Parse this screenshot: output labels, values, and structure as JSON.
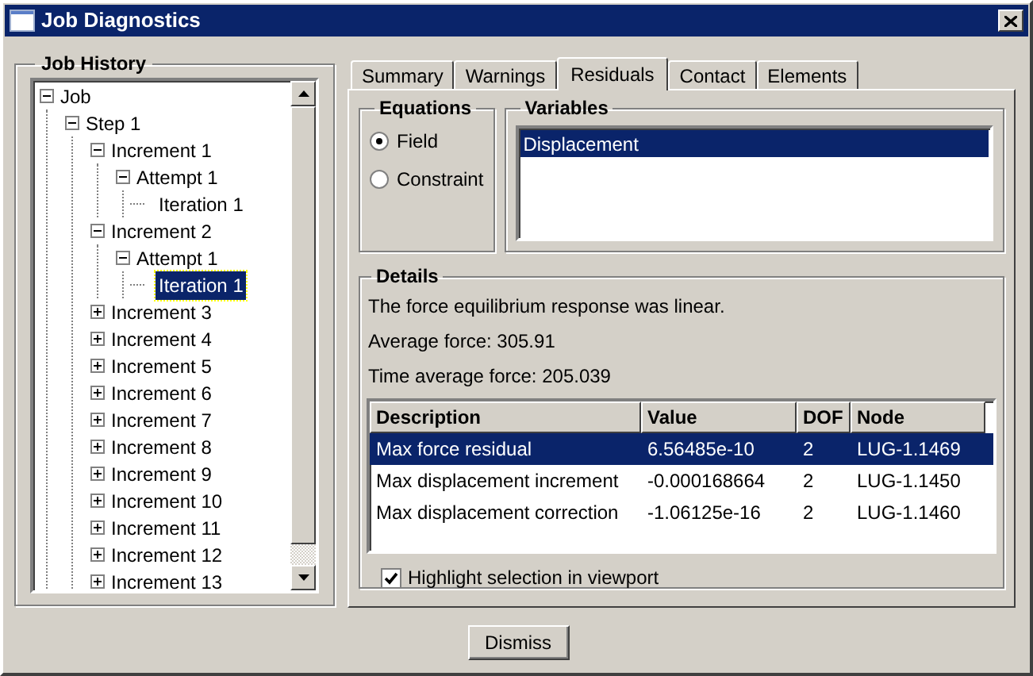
{
  "window": {
    "title": "Job Diagnostics"
  },
  "job_history": {
    "title": "Job History",
    "tree": [
      {
        "label": "Job",
        "expanded": true,
        "selected": false,
        "children": [
          {
            "label": "Step 1",
            "expanded": true,
            "selected": false,
            "children": [
              {
                "label": "Increment 1",
                "expanded": true,
                "selected": false,
                "children": [
                  {
                    "label": "Attempt 1",
                    "expanded": true,
                    "selected": false,
                    "children": [
                      {
                        "label": "Iteration 1",
                        "selected": false
                      }
                    ]
                  }
                ]
              },
              {
                "label": "Increment 2",
                "expanded": true,
                "selected": false,
                "children": [
                  {
                    "label": "Attempt 1",
                    "expanded": true,
                    "selected": false,
                    "children": [
                      {
                        "label": "Iteration 1",
                        "selected": true
                      }
                    ]
                  }
                ]
              },
              {
                "label": "Increment 3",
                "expanded": false,
                "selected": false
              },
              {
                "label": "Increment 4",
                "expanded": false,
                "selected": false
              },
              {
                "label": "Increment 5",
                "expanded": false,
                "selected": false
              },
              {
                "label": "Increment 6",
                "expanded": false,
                "selected": false
              },
              {
                "label": "Increment 7",
                "expanded": false,
                "selected": false
              },
              {
                "label": "Increment 8",
                "expanded": false,
                "selected": false
              },
              {
                "label": "Increment 9",
                "expanded": false,
                "selected": false
              },
              {
                "label": "Increment 10",
                "expanded": false,
                "selected": false
              },
              {
                "label": "Increment 11",
                "expanded": false,
                "selected": false
              },
              {
                "label": "Increment 12",
                "expanded": false,
                "selected": false
              },
              {
                "label": "Increment 13",
                "expanded": false,
                "selected": false
              }
            ]
          }
        ]
      }
    ]
  },
  "tabs": [
    {
      "label": "Summary",
      "selected": false
    },
    {
      "label": "Warnings",
      "selected": false
    },
    {
      "label": "Residuals",
      "selected": true
    },
    {
      "label": "Contact",
      "selected": false
    },
    {
      "label": "Elements",
      "selected": false
    }
  ],
  "equations": {
    "title": "Equations",
    "options": [
      {
        "label": "Field",
        "selected": true
      },
      {
        "label": "Constraint",
        "selected": false
      }
    ]
  },
  "variables": {
    "title": "Variables",
    "items": [
      {
        "label": "Displacement",
        "selected": true
      }
    ]
  },
  "details": {
    "title": "Details",
    "lines": [
      "The force equilibrium response was linear.",
      "Average force: 305.91",
      "Time average force: 205.039"
    ],
    "table": {
      "columns": [
        "Description",
        "Value",
        "DOF",
        "Node"
      ],
      "rows": [
        {
          "cells": [
            "Max force residual",
            "6.56485e-10",
            "2",
            "LUG-1.1469"
          ],
          "selected": true
        },
        {
          "cells": [
            "Max displacement increment",
            "-0.000168664",
            "2",
            "LUG-1.1450"
          ],
          "selected": false
        },
        {
          "cells": [
            "Max displacement correction",
            "-1.06125e-16",
            "2",
            "LUG-1.1460"
          ],
          "selected": false
        }
      ]
    },
    "highlight_checkbox": {
      "label": "Highlight selection in viewport",
      "checked": true
    }
  },
  "buttons": [
    "Dismiss"
  ]
}
